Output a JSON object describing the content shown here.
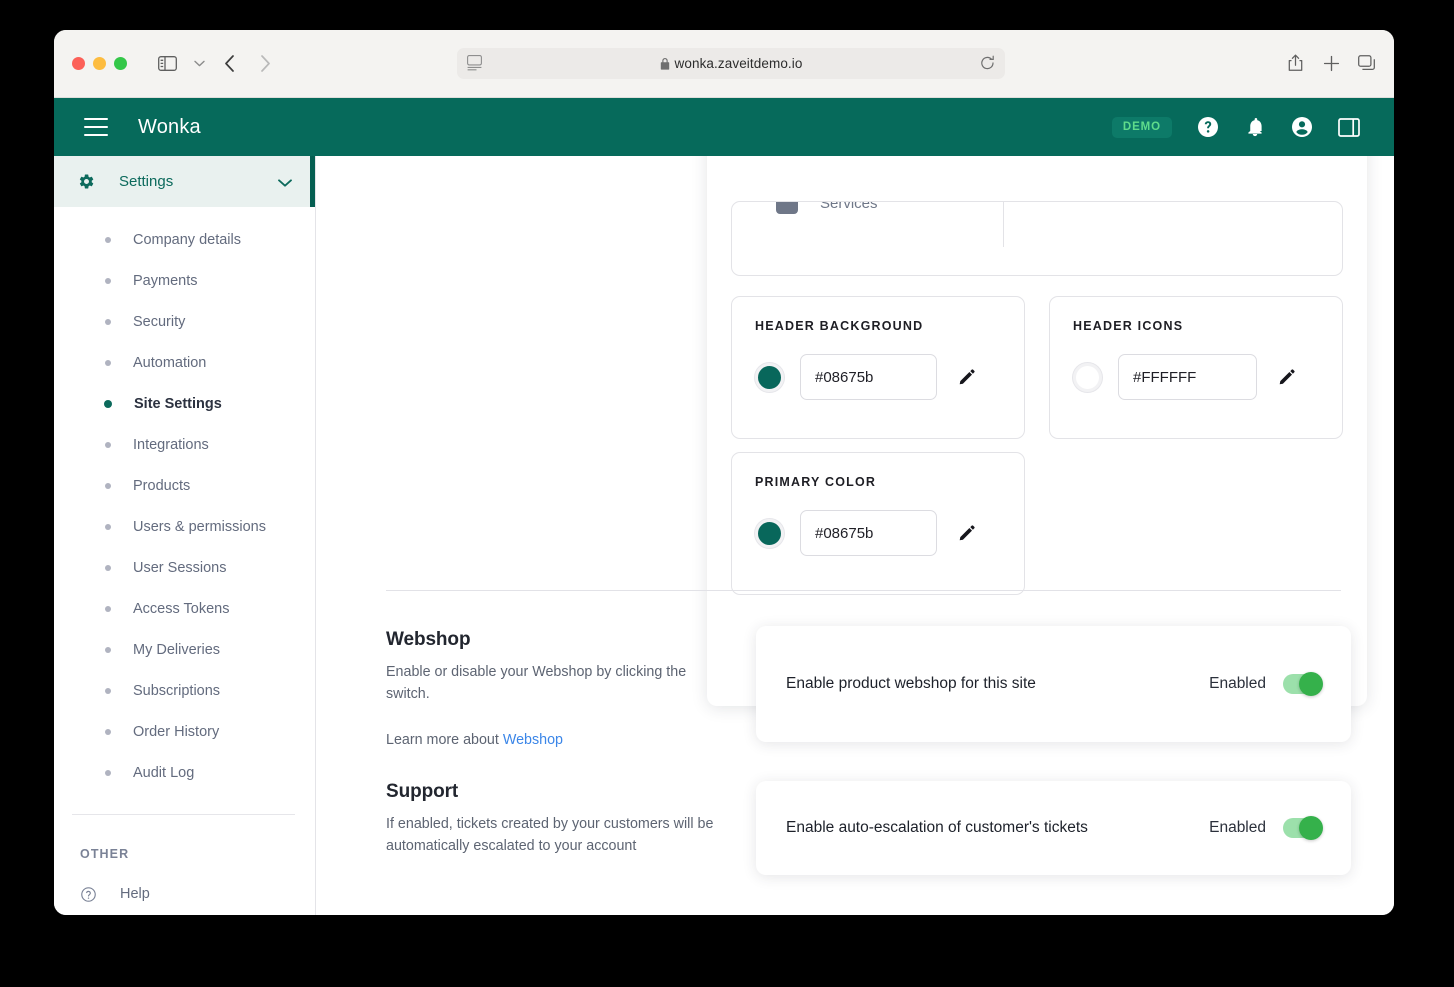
{
  "browser": {
    "url": "wonka.zaveitdemo.io",
    "icons": {
      "sidebar": "sidebar-toggle-icon",
      "chevron": "chevron-down-icon",
      "back": "back-arrow-icon",
      "forward": "forward-arrow-icon",
      "reader": "reader-view-icon",
      "lock": "lock-icon",
      "reload": "reload-icon",
      "share": "share-icon",
      "plus": "new-tab-icon",
      "tabs": "tab-overview-icon"
    }
  },
  "app_header": {
    "brand": "Wonka",
    "badge": "DEMO",
    "icons": [
      "help-circle-icon",
      "bell-icon",
      "account-circle-icon",
      "panel-toggle-icon"
    ]
  },
  "sidebar": {
    "group_title": "Settings",
    "items": [
      {
        "label": "Company details",
        "active": false
      },
      {
        "label": "Payments",
        "active": false
      },
      {
        "label": "Security",
        "active": false
      },
      {
        "label": "Automation",
        "active": false
      },
      {
        "label": "Site Settings",
        "active": true
      },
      {
        "label": "Integrations",
        "active": false
      },
      {
        "label": "Products",
        "active": false
      },
      {
        "label": "Users & permissions",
        "active": false
      },
      {
        "label": "User Sessions",
        "active": false
      },
      {
        "label": "Access Tokens",
        "active": false
      },
      {
        "label": "My Deliveries",
        "active": false
      },
      {
        "label": "Subscriptions",
        "active": false
      },
      {
        "label": "Order History",
        "active": false
      },
      {
        "label": "Audit Log",
        "active": false
      }
    ],
    "other_title": "OTHER",
    "help_label": "Help"
  },
  "main": {
    "services_card": {
      "label": "Services"
    },
    "color_cards": [
      {
        "title": "HEADER BACKGROUND",
        "value": "#08675b",
        "swatch": "#08675b"
      },
      {
        "title": "HEADER ICONS",
        "value": "#FFFFFF",
        "swatch": "#FFFFFF"
      },
      {
        "title": "PRIMARY COLOR",
        "value": "#08675b",
        "swatch": "#08675b"
      }
    ],
    "sections": [
      {
        "title": "Webshop",
        "desc": "Enable or disable your Webshop by clicking the switch.",
        "learn_prefix": "Learn more about ",
        "learn_link": "Webshop",
        "toggle_label": "Enable product webshop for this site",
        "toggle_state": "Enabled"
      },
      {
        "title": "Support",
        "desc": "If enabled, tickets created by your customers will be automatically escalated to your account",
        "toggle_label": "Enable auto-escalation of customer's tickets",
        "toggle_state": "Enabled"
      }
    ]
  },
  "colors": {
    "header_green": "#066a5b",
    "accent_teal": "#0c6a5c",
    "toggle_on": "#35b14b",
    "link_blue": "#3b86e8"
  }
}
